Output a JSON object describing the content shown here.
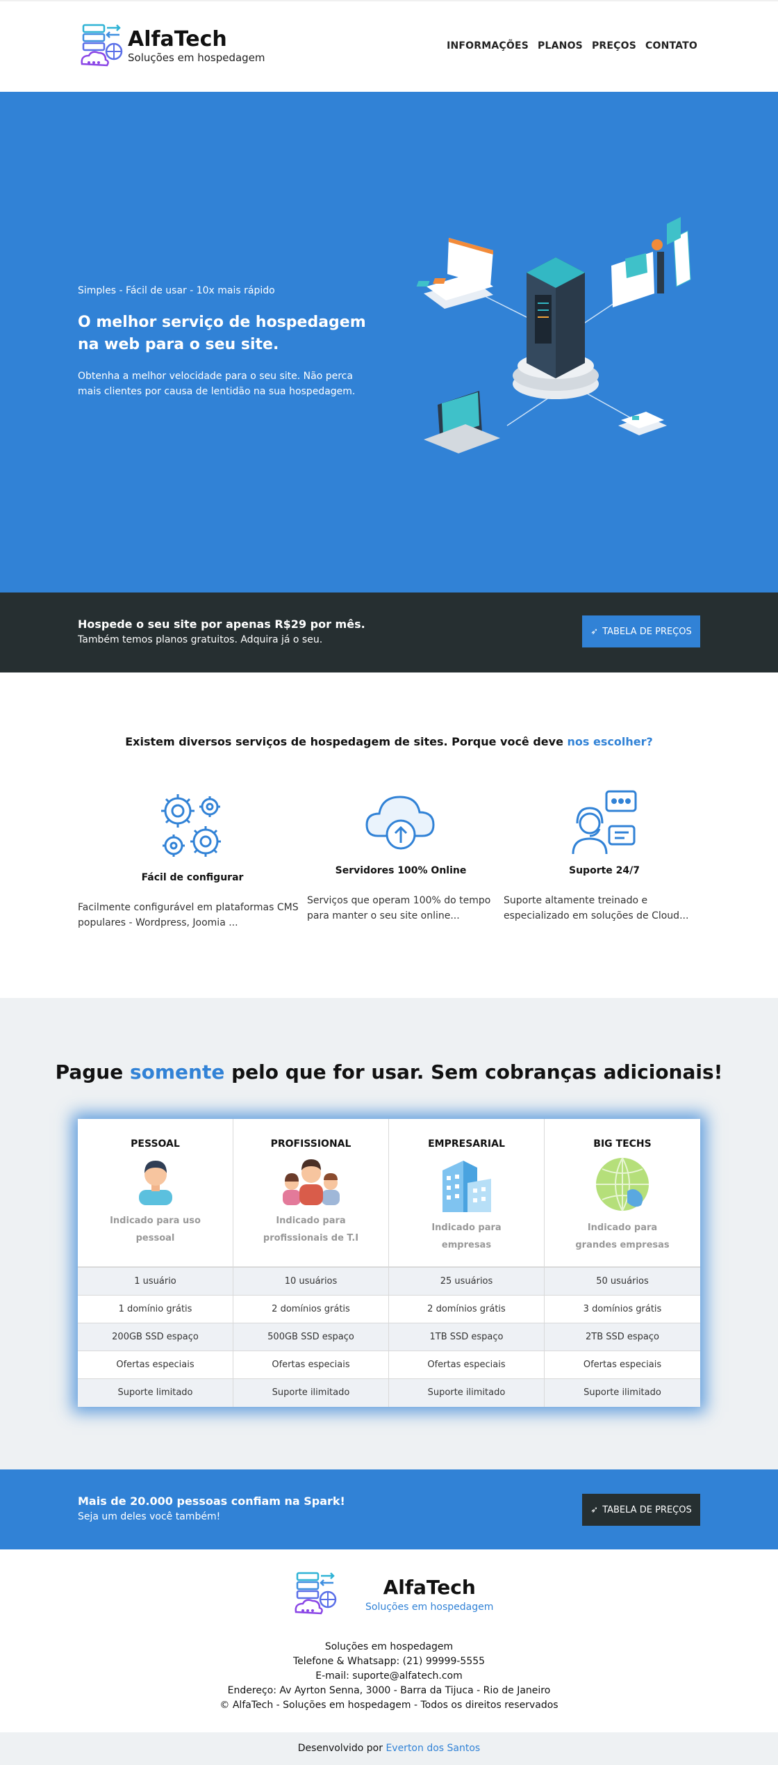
{
  "brand": {
    "name": "AlfaTech",
    "tagline": "Soluções em hospedagem"
  },
  "nav": [
    "INFORMAÇÕES",
    "PLANOS",
    "PREÇOS",
    "CONTATO"
  ],
  "hero": {
    "tag": "Simples - Fácil de usar - 10x mais rápido",
    "title": "O melhor serviço de hospedagem na web para o seu site.",
    "description": "Obtenha a melhor velocidade para o seu site. Não perca mais clientes por causa de lentidão na sua hospedagem."
  },
  "cta_top": {
    "title": "Hospede o seu site por apenas R$29 por mês.",
    "subtitle": "Também temos planos gratuitos. Adquira já o seu.",
    "button": "TABELA DE PREÇOS"
  },
  "why": {
    "title_prefix": "Existem diversos serviços de hospedagem de sites. Porque você deve",
    "title_highlight": "nos escolher?",
    "features": [
      {
        "icon": "gears-icon",
        "title": "Fácil de configurar",
        "text": "Facilmente configurável em plataformas CMS populares - Wordpress, Joomia ..."
      },
      {
        "icon": "cloud-upload-icon",
        "title": "Servidores 100% Online",
        "text": "Serviços que operam 100% do tempo para manter o seu site online..."
      },
      {
        "icon": "support-agent-icon",
        "title": "Suporte 24/7",
        "text": "Suporte altamente treinado e especializado em soluções de Cloud..."
      }
    ]
  },
  "pricing": {
    "title_prefix": "Pague",
    "title_highlight": "somente",
    "title_suffix": "pelo que for usar. Sem cobranças adicionais!",
    "plans": [
      {
        "name": "PESSOAL",
        "icon": "person-icon",
        "indicated": "Indicado para uso pessoal",
        "features": [
          "1 usuário",
          "1 domínio grátis",
          "200GB SSD espaço",
          "Ofertas especiais",
          "Suporte limitado"
        ]
      },
      {
        "name": "PROFISSIONAL",
        "icon": "team-icon",
        "indicated": "Indicado para profissionais de T.I",
        "features": [
          "10 usuários",
          "2 domínios grátis",
          "500GB SSD espaço",
          "Ofertas especiais",
          "Suporte ilimitado"
        ]
      },
      {
        "name": "EMPRESARIAL",
        "icon": "building-icon",
        "indicated": "Indicado para empresas",
        "features": [
          "25 usuários",
          "2 domínios grátis",
          "1TB SSD espaço",
          "Ofertas especiais",
          "Suporte ilimitado"
        ]
      },
      {
        "name": "BIG TECHS",
        "icon": "globe-icon",
        "indicated": "Indicado para grandes empresas",
        "features": [
          "50 usuários",
          "3 domínios grátis",
          "2TB SSD espaço",
          "Ofertas especiais",
          "Suporte ilimitado"
        ]
      }
    ]
  },
  "cta_bottom": {
    "title": "Mais de 20.000 pessoas confiam na Spark!",
    "subtitle": "Seja um deles você também!",
    "button": "TABELA DE PREÇOS"
  },
  "footer": {
    "lines": [
      "Soluções em hospedagem",
      "Telefone & Whatsapp: (21) 99999-5555",
      "E-mail: suporte@alfatech.com",
      "Endereço: Av Ayrton Senna, 3000 - Barra da Tijuca - Rio de Janeiro",
      "© AlfaTech - Soluções em hospedagem - Todos os direitos reservados"
    ],
    "credit_prefix": "Desenvolvido por",
    "credit_author": "Everton dos Santos"
  },
  "colors": {
    "primary": "#3182d6",
    "dark": "#262f31",
    "light_bg": "#eef1f3"
  }
}
